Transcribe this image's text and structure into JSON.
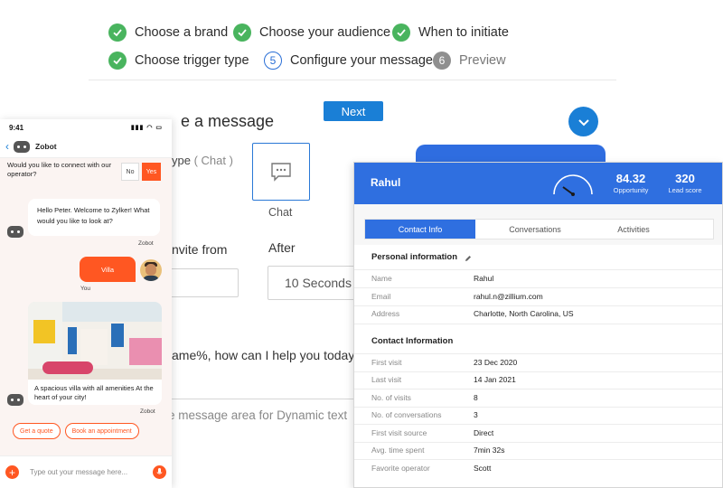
{
  "steps": [
    {
      "label": "Choose a brand",
      "state": "done"
    },
    {
      "label": "Choose your audience",
      "state": "done"
    },
    {
      "label": "When to initiate",
      "state": "done"
    },
    {
      "label": "Choose trigger type",
      "state": "done"
    },
    {
      "number": "5",
      "label": "Configure your message",
      "state": "current"
    },
    {
      "number": "6",
      "label": "Preview",
      "state": "future"
    }
  ],
  "configure": {
    "next_label": "Next",
    "heading_fragment": "e a message",
    "type_fragment": "ype",
    "type_value": "( Chat )",
    "chat_type_label": "Chat",
    "invite_from_fragment": "nvite from",
    "after_label": "After",
    "after_value": "10 Seconds",
    "message_fragment": "ame%, how can I help you today?",
    "dynamic_fragment": "e message area for Dynamic text"
  },
  "phone": {
    "time": "9:41",
    "bot_name": "Zobot",
    "connect_prompt": "Would you like to connect with our operator?",
    "no_label": "No",
    "yes_label": "Yes",
    "greeting": "Hello Peter. Welcome to Zylker! What would you like to look at?",
    "bot_label": "Zobot",
    "user_message": "Villa",
    "you_label": "You",
    "villa_caption": "A spacious villa with all amenities At the heart of your city!",
    "bot_label_2": "Zobot",
    "quick_replies": [
      "Get a quote",
      "Book an appointment"
    ],
    "composer_placeholder": "Type out your message here...",
    "colors": {
      "accent": "#ff5722"
    }
  },
  "visitor": {
    "name": "Rahul",
    "opportunity_value": "84.32",
    "opportunity_label": "Opportunity",
    "lead_score_value": "320",
    "lead_score_label": "Lead score",
    "tabs": [
      "Contact Info",
      "Conversations",
      "Activities"
    ],
    "personal_title": "Personal information",
    "personal": [
      {
        "key": "Name",
        "value": "Rahul"
      },
      {
        "key": "Email",
        "value": "rahul.n@zillium.com"
      },
      {
        "key": "Address",
        "value": "Charlotte, North Carolina, US"
      }
    ],
    "contact_title": "Contact Information",
    "contact": [
      {
        "key": "First visit",
        "value": "23 Dec 2020"
      },
      {
        "key": "Last visit",
        "value": "14 Jan 2021"
      },
      {
        "key": "No. of visits",
        "value": "8"
      },
      {
        "key": "No. of conversations",
        "value": "3"
      },
      {
        "key": "First visit source",
        "value": "Direct"
      },
      {
        "key": "Avg. time spent",
        "value": "7min 32s"
      },
      {
        "key": "Favorite operator",
        "value": "Scott"
      }
    ],
    "colors": {
      "header": "#2f6fe0"
    }
  }
}
